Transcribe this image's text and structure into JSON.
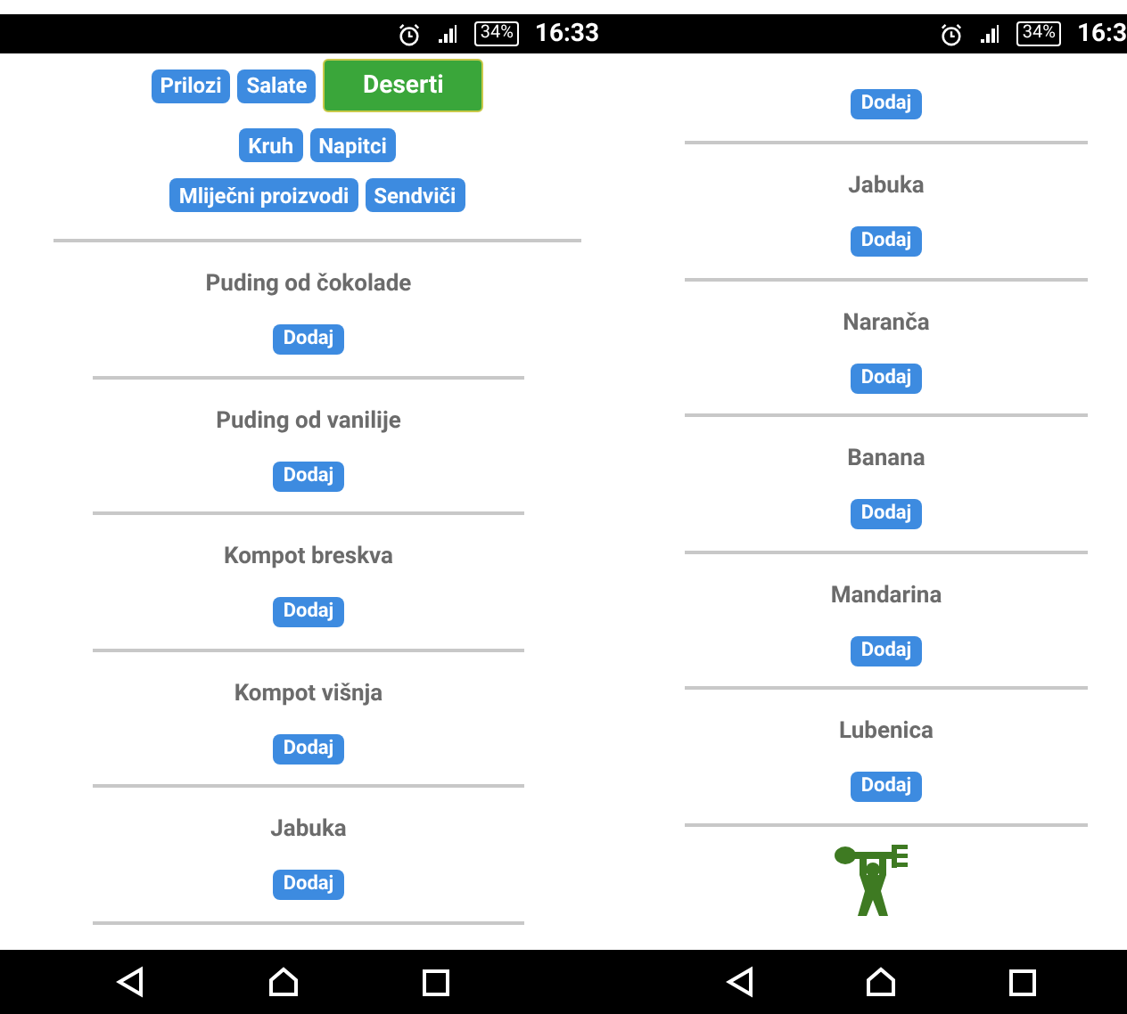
{
  "screens": [
    {
      "status_bar": {
        "battery": "34%",
        "time": "16:33"
      },
      "category_rows": [
        [
          {
            "label": "Prilozi",
            "selected": false
          },
          {
            "label": "Salate",
            "selected": false
          },
          {
            "label": "Deserti",
            "selected": true
          }
        ],
        [
          {
            "label": "Kruh",
            "selected": false
          },
          {
            "label": "Napitci",
            "selected": false
          }
        ],
        [
          {
            "label": "Mliječni proizvodi",
            "selected": false
          },
          {
            "label": "Sendviči",
            "selected": false
          }
        ]
      ],
      "items": [
        {
          "name": "Puding od čokolade",
          "button": "Dodaj"
        },
        {
          "name": "Puding od vanilije",
          "button": "Dodaj"
        },
        {
          "name": "Kompot breskva",
          "button": "Dodaj"
        },
        {
          "name": "Kompot višnja",
          "button": "Dodaj"
        },
        {
          "name": "Jabuka",
          "button": "Dodaj"
        }
      ]
    },
    {
      "status_bar": {
        "battery": "34%",
        "time": "16:3"
      },
      "items": [
        {
          "button": "Dodaj"
        },
        {
          "name": "Jabuka",
          "button": "Dodaj"
        },
        {
          "name": "Naranča",
          "button": "Dodaj"
        },
        {
          "name": "Banana",
          "button": "Dodaj"
        },
        {
          "name": "Mandarina",
          "button": "Dodaj"
        },
        {
          "name": "Lubenica",
          "button": "Dodaj"
        }
      ],
      "logo": true
    }
  ]
}
